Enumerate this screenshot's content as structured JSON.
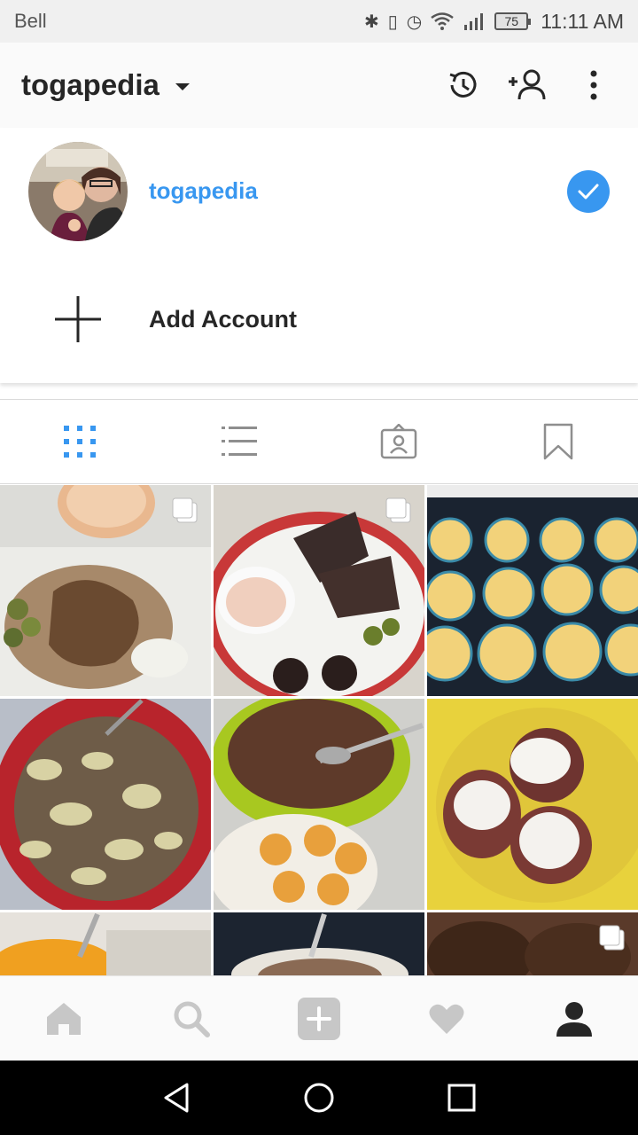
{
  "status_bar": {
    "carrier": "Bell",
    "battery": "75",
    "time": "11:11 AM"
  },
  "header": {
    "username": "togapedia"
  },
  "dropdown": {
    "accounts": [
      {
        "username": "togapedia",
        "selected": true
      }
    ],
    "add_account_label": "Add Account"
  },
  "tabs": [
    {
      "name": "grid",
      "icon": "grid-icon",
      "active": true
    },
    {
      "name": "list",
      "icon": "list-icon",
      "active": false
    },
    {
      "name": "tagged",
      "icon": "tagged-icon",
      "active": false
    },
    {
      "name": "saved",
      "icon": "bookmark-icon",
      "active": false
    }
  ],
  "posts": [
    {
      "subject": "chicken with olives and dip",
      "multi": true
    },
    {
      "subject": "steak with dip, olives and chocolate",
      "multi": true
    },
    {
      "subject": "muffin tray of puffed egg cups",
      "multi": false
    },
    {
      "subject": "ground beef and cabbage in red bowl",
      "multi": false
    },
    {
      "subject": "chocolate crumble in green bowl",
      "multi": false
    },
    {
      "subject": "cheese topped cups on yellow plate",
      "multi": false
    },
    {
      "subject": "egg in bowl",
      "multi": false
    },
    {
      "subject": "ground meat on plate",
      "multi": false
    },
    {
      "subject": "burger patties",
      "multi": true
    }
  ],
  "bottom_nav": [
    "home-icon",
    "search-icon",
    "add-post-icon",
    "activity-heart-icon",
    "profile-icon"
  ],
  "colors": {
    "accent": "#3897f0",
    "text": "#262626",
    "inactive_icon": "#c7c7c7"
  }
}
